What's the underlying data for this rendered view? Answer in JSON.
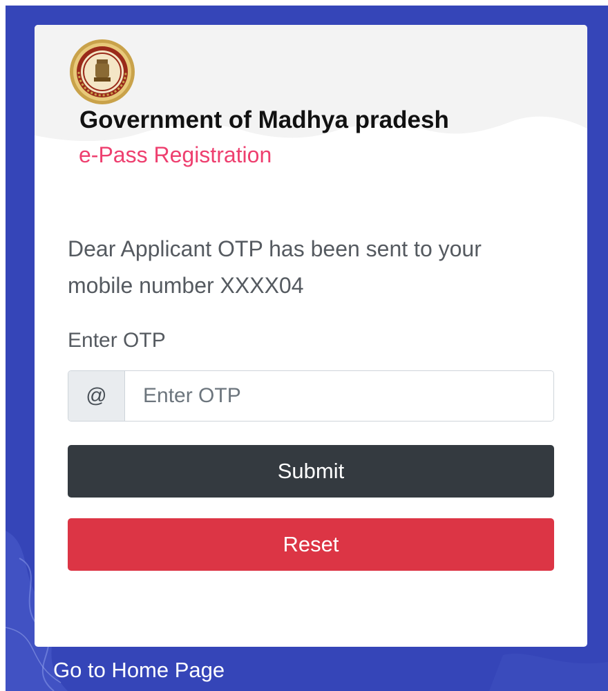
{
  "colors": {
    "background": "#3545b8",
    "card": "#ffffff",
    "title": "#111111",
    "subtitle": "#ee3f6f",
    "submit_button": "#343a40",
    "reset_button": "#dc3545"
  },
  "header": {
    "emblem_icon": "mp-government-emblem-icon",
    "title": "Government of Madhya pradesh",
    "subtitle": "e-Pass Registration"
  },
  "main": {
    "message": "Dear Applicant OTP has been sent to your mobile number XXXX04",
    "otp_label": "Enter OTP",
    "otp_prefix": "@",
    "otp_input": {
      "value": "",
      "placeholder": "Enter OTP"
    },
    "submit_label": "Submit",
    "reset_label": "Reset"
  },
  "footer": {
    "home_link": "Go to Home Page"
  }
}
